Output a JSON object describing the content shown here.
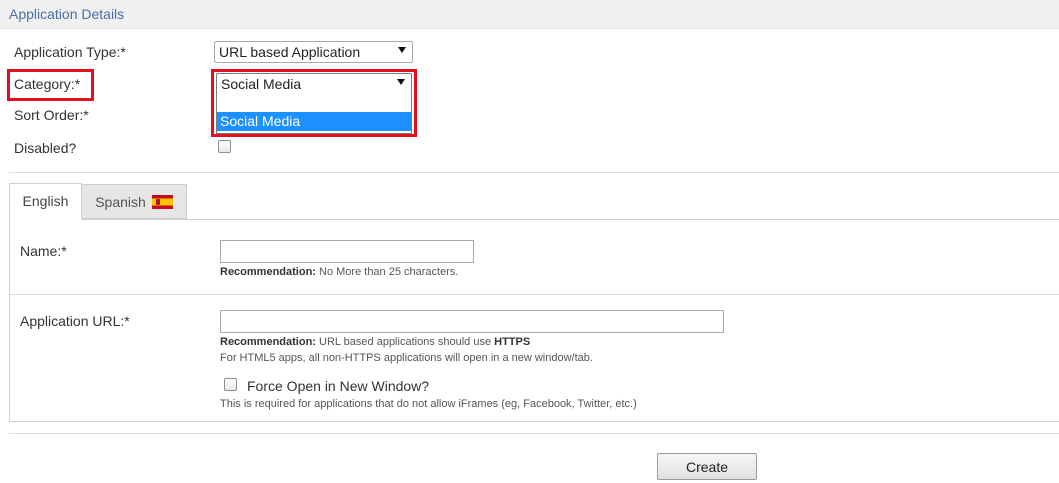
{
  "section": {
    "title": "Application Details"
  },
  "form": {
    "application_type": {
      "label": "Application Type:*",
      "value": "URL based Application"
    },
    "category": {
      "label": "Category:*",
      "value": "Social Media",
      "options": [
        "",
        "Social Media"
      ],
      "highlighted_option": "Social Media"
    },
    "sort_order": {
      "label": "Sort Order:*"
    },
    "disabled": {
      "label": "Disabled?",
      "checked": false
    }
  },
  "tabs": [
    {
      "label": "English",
      "active": true
    },
    {
      "label": "Spanish",
      "active": false,
      "icon": "spain-flag-icon"
    }
  ],
  "name_field": {
    "label": "Name:*",
    "value": "",
    "hint_bold": "Recommendation:",
    "hint_text": " No More than 25 characters."
  },
  "url_field": {
    "label": "Application URL:*",
    "value": "",
    "hint_bold": "Recommendation:",
    "hint_text": " URL based applications should use ",
    "hint_bold2": "HTTPS",
    "hint_line2": "For HTML5 apps, all non-HTTPS applications will open in a new window/tab."
  },
  "force_open": {
    "label": "Force Open in New Window?",
    "checked": false,
    "hint": "This is required for applications that do not allow iFrames (eg, Facebook, Twitter, etc.)"
  },
  "actions": {
    "create_label": "Create"
  },
  "colors": {
    "highlight": "#e3101e",
    "header_text": "#4a6fa5",
    "selected_option": "#1e90ff"
  }
}
